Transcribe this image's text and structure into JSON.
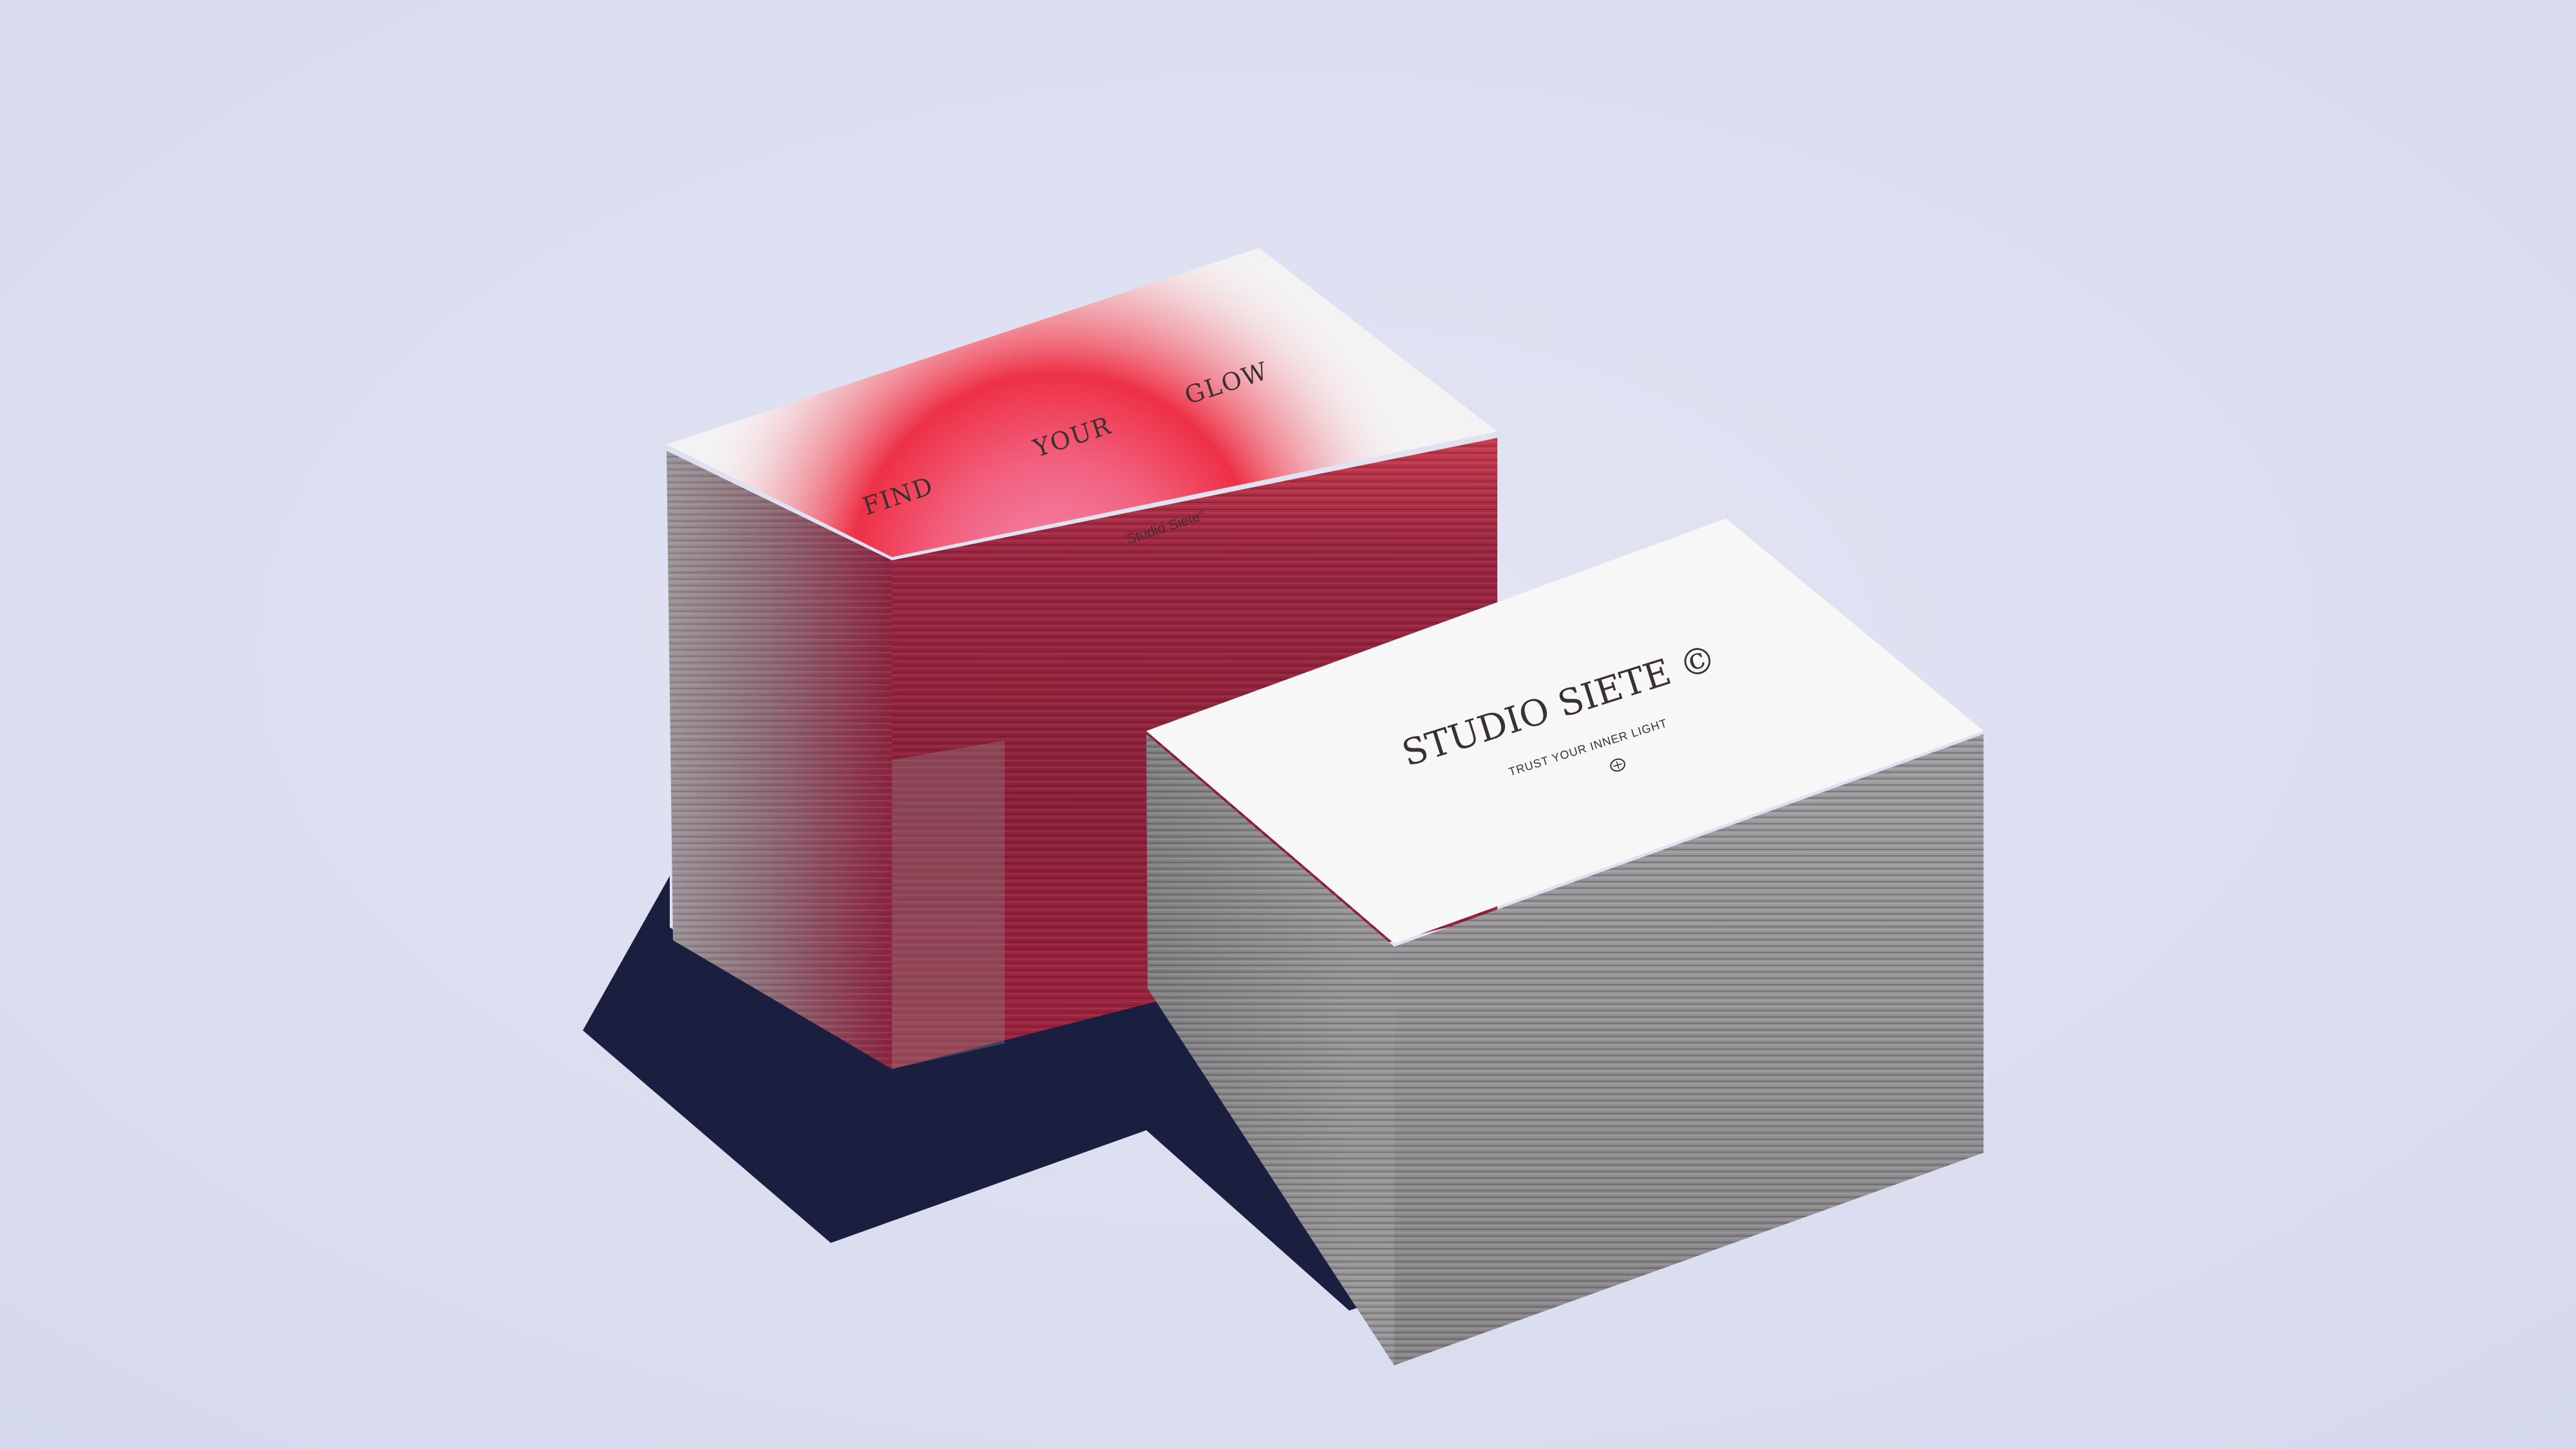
{
  "colors": {
    "background": "#dcdff0",
    "shadow": "#1b1f3f",
    "card_face": "#f4f2f3",
    "glow_red": "#ec2e44",
    "glow_pink": "#f27aa0",
    "edge_red": "#8f2138",
    "edge_gray": "#8c8a8c",
    "ink": "#3a3034"
  },
  "left_stack": {
    "words": [
      "FIND",
      "YOUR",
      "GLOW"
    ],
    "brand": "Studio Siete°"
  },
  "right_stack": {
    "title": "STUDIO SIETE ©",
    "tagline": "TRUST YOUR INNER LIGHT",
    "logo_icon": "circle-mark-icon"
  }
}
